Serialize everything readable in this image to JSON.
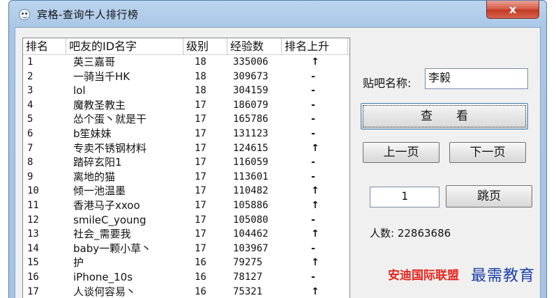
{
  "window": {
    "title": "宾格-查询牛人排行榜",
    "close_label": "x"
  },
  "table": {
    "columns": [
      "排名",
      "吧友的ID名字",
      "级别",
      "经验数",
      "排名上升"
    ],
    "rows": [
      [
        "1",
        "英三嘉哥",
        "18",
        "335006",
        "↑"
      ],
      [
        "2",
        "一骑当千HK",
        "18",
        "309673",
        "-"
      ],
      [
        "3",
        "lol",
        "18",
        "304159",
        "-"
      ],
      [
        "4",
        "魔教圣教主",
        "17",
        "186079",
        "-"
      ],
      [
        "5",
        "怂个蛋丶就是干",
        "17",
        "165786",
        "-"
      ],
      [
        "6",
        "b笙妹妹",
        "17",
        "131123",
        "-"
      ],
      [
        "7",
        "专卖不锈钢材料",
        "17",
        "124615",
        "↑"
      ],
      [
        "8",
        "踏碎玄阳1",
        "17",
        "116059",
        "-"
      ],
      [
        "9",
        "离地的猫",
        "17",
        "113601",
        "-"
      ],
      [
        "10",
        "倾一池温墨",
        "17",
        "110482",
        "↑"
      ],
      [
        "11",
        "香港马子xxoo",
        "17",
        "105886",
        "↑"
      ],
      [
        "12",
        "smileC_young",
        "17",
        "105080",
        "-"
      ],
      [
        "13",
        "社会_需要我",
        "17",
        "104462",
        "↑"
      ],
      [
        "14",
        "baby一颗小草丶",
        "17",
        "103967",
        "-"
      ],
      [
        "15",
        "护",
        "16",
        "79275",
        "↑"
      ],
      [
        "16",
        "iPhone_10s",
        "16",
        "78127",
        "-"
      ],
      [
        "17",
        "人谈何容易丶",
        "16",
        "75321",
        "↑"
      ]
    ]
  },
  "panel": {
    "bar_name_label": "贴吧名称:",
    "bar_name_value": "李毅",
    "view_button": "查　　看",
    "prev_button": "上一页",
    "next_button": "下一页",
    "page_value": "1",
    "jump_button": "跳页",
    "count_text": "人数: 22863686"
  },
  "watermark": {
    "red_text": "安迪国际联盟",
    "blue_text": "最需教育"
  }
}
